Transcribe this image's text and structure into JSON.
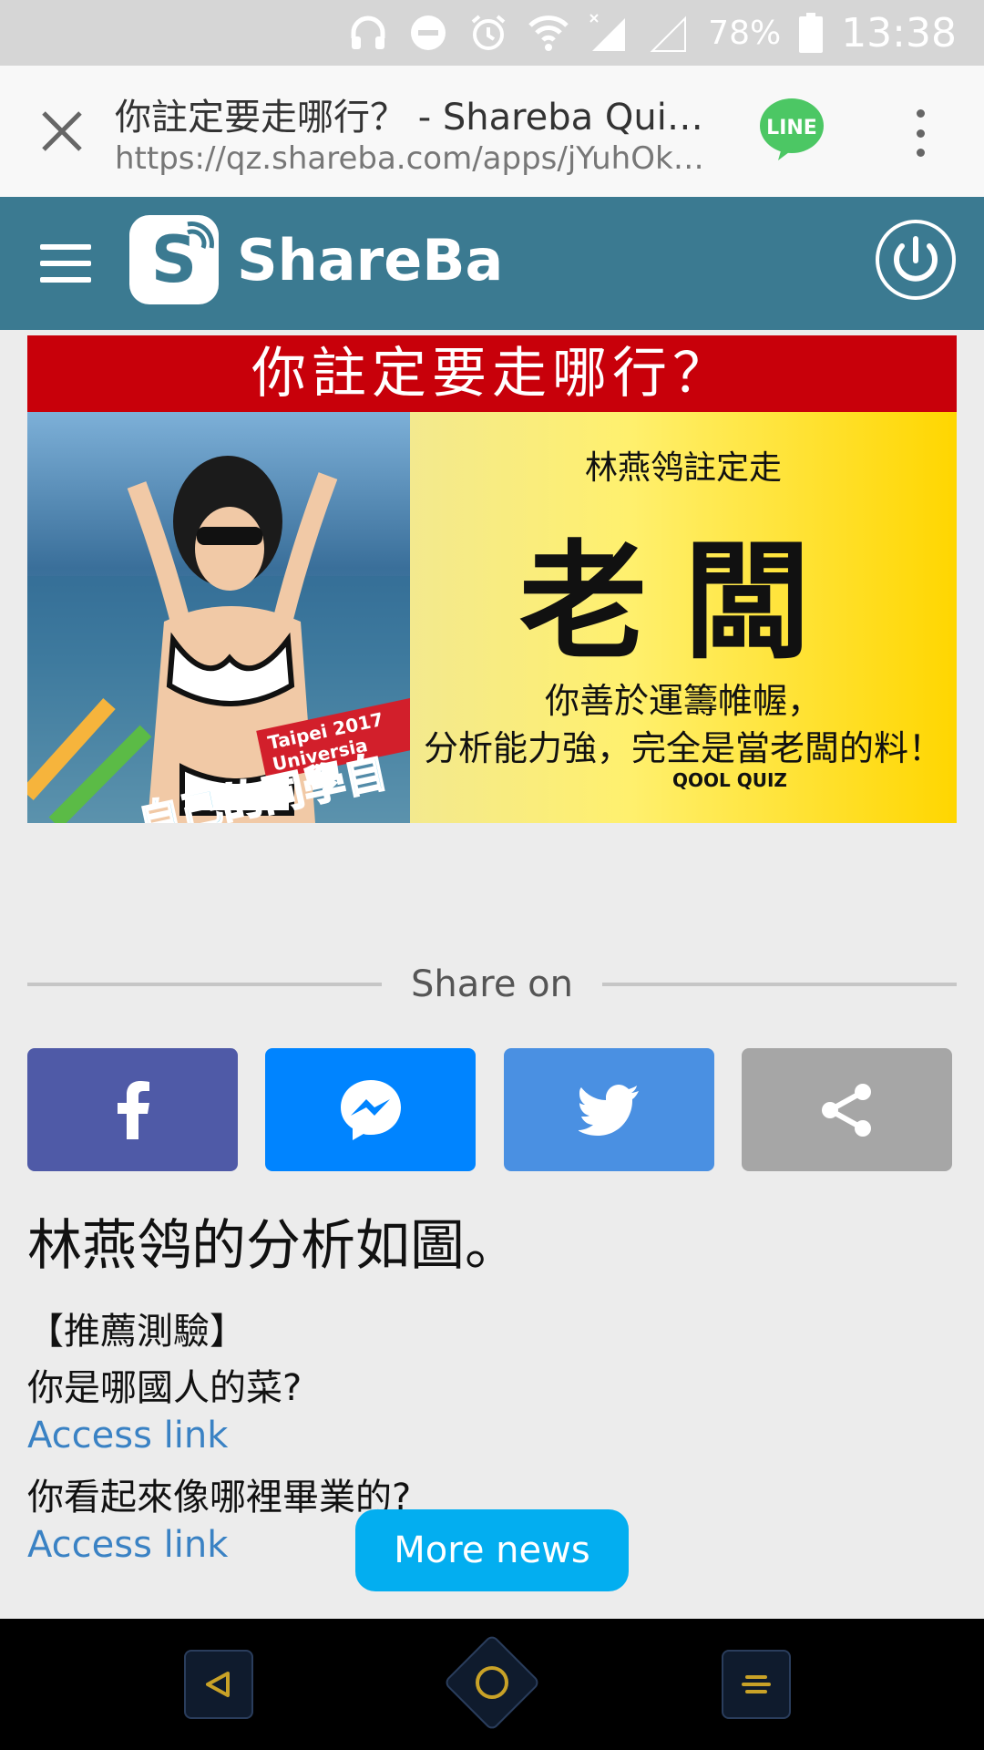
{
  "status_bar": {
    "battery_percent": "78%",
    "time": "13:38",
    "icons": [
      "headphones-icon",
      "do-not-disturb-icon",
      "alarm-icon",
      "wifi-icon",
      "cellular-signal-icon",
      "cellular-signal-empty-icon",
      "battery-icon"
    ]
  },
  "browser": {
    "page_title": "你註定要走哪行？ - Shareba Quiz...",
    "url": "https://qz.shareba.com/apps/jYuhOkP...",
    "line_label": "LINE"
  },
  "site_header": {
    "logo_letter": "S",
    "logo_text": "ShareBa"
  },
  "hero": {
    "banner_text": "你註定要走哪行？",
    "result_subtitle": "林燕鸰註定走",
    "result_main": "老闆",
    "result_desc_line1": "你善於運籌帷幄，",
    "result_desc_line2": "分析能力強，完全是當老闆的料！",
    "brand": "QOOL QUIZ",
    "photo_overlay_red": "Taipei 2017 Universia",
    "photo_overlay_green": "自己的同學自己拉"
  },
  "share": {
    "heading": "Share on",
    "buttons": [
      {
        "name": "facebook",
        "icon": "facebook-icon",
        "color": "#4f5aa7"
      },
      {
        "name": "messenger",
        "icon": "messenger-icon",
        "color": "#0084ff"
      },
      {
        "name": "twitter",
        "icon": "twitter-icon",
        "color": "#4a90e2"
      },
      {
        "name": "share",
        "icon": "share-icon",
        "color": "#a6a6a6"
      }
    ]
  },
  "content": {
    "analysis_text": "林燕鸰的分析如圖。",
    "recommend_heading": "【推薦測驗】",
    "quiz1_title": "你是哪國人的菜?",
    "quiz1_link": "Access link",
    "quiz2_title": "你看起來像哪裡畢業的?",
    "quiz2_link": "Access link",
    "more_news": "More news"
  },
  "colors": {
    "header_bg": "#3b7a91",
    "link": "#3a82c4",
    "more_news_bg": "#03aef0",
    "banner_red": "#c8000a"
  }
}
